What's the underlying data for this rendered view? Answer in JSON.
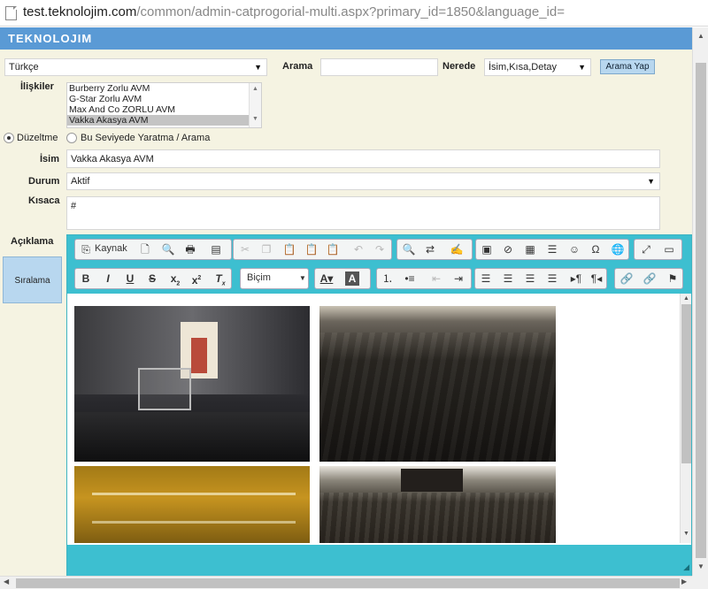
{
  "address_bar": {
    "url_domain": "test.teknolojim.com",
    "url_path": "/common/admin-catprogorial-multi.aspx?primary_id=1850&language_id="
  },
  "header": {
    "logo": "TEKNOLOJIM"
  },
  "form": {
    "language_select": "Türkçe",
    "search_label": "Arama",
    "search_value": "",
    "where_label": "Nerede",
    "where_select": "İsim,Kısa,Detay",
    "search_button": "Arama Yap",
    "relations_label": "İlişkiler",
    "relations_items": [
      "Burberry Zorlu AVM",
      "G-Star Zorlu AVM",
      "Max And Co ZORLU AVM",
      "Vakka Akasya AVM"
    ],
    "radio_edit": "Düzeltme",
    "radio_create": "Bu Seviyede Yaratma / Arama",
    "name_label": "İsim",
    "name_value": "Vakka Akasya AVM",
    "status_label": "Durum",
    "status_value": "Aktif",
    "short_label": "Kısaca",
    "short_value": "#",
    "desc_label": "Açıklama",
    "sort_button": "Sıralama"
  },
  "editor": {
    "source_label": "Kaynak",
    "format_label": "Biçim",
    "icons": {
      "source": "source-icon",
      "new_page": "new-page-icon",
      "preview": "preview-icon",
      "print": "print-icon",
      "templates": "templates-icon",
      "cut": "cut-icon",
      "copy": "copy-icon",
      "paste": "paste-icon",
      "paste_text": "paste-text-icon",
      "paste_word": "paste-word-icon",
      "undo": "undo-icon",
      "redo": "redo-icon",
      "find": "find-icon",
      "replace": "replace-icon",
      "spellcheck": "spellcheck-icon",
      "image": "image-icon",
      "flash": "flash-icon",
      "table": "table-icon",
      "hr": "horizontal-rule-icon",
      "smiley": "smiley-icon",
      "special_char": "special-char-icon",
      "iframe": "iframe-icon",
      "maximize": "maximize-icon",
      "show_blocks": "show-blocks-icon"
    },
    "images": [
      "store interior photo 1",
      "dark wood floor photo 1",
      "golden display shelf photo",
      "dark wood floor photo 2"
    ]
  },
  "colors": {
    "header_bg": "#5a9ad5",
    "form_bg": "#f5f3e2",
    "editor_toolbar": "#3dbfd0",
    "button_bg": "#b8d7ef"
  }
}
